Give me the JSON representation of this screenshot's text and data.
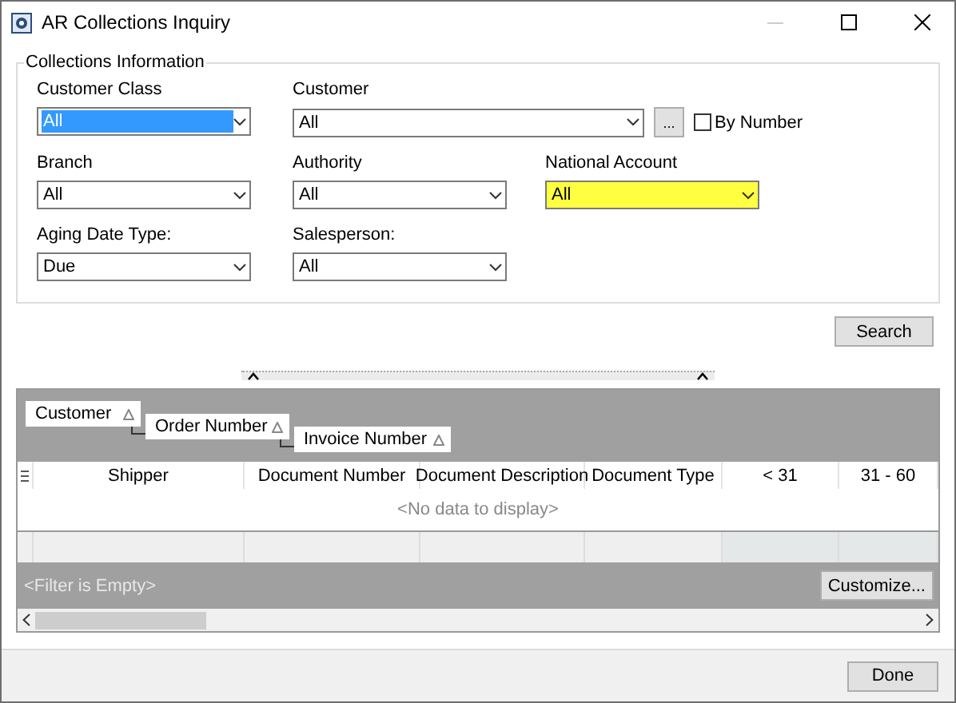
{
  "window": {
    "title": "AR Collections Inquiry"
  },
  "group": {
    "title": "Collections Information",
    "rows": [
      {
        "fields": [
          {
            "label": "Customer Class",
            "value": "All",
            "focused": true,
            "highlighted": false
          },
          {
            "label": "Customer",
            "value": "All",
            "focused": false,
            "highlighted": false,
            "lookup_button": "...",
            "by_number": {
              "label": "By Number",
              "checked": false
            }
          }
        ]
      },
      {
        "fields": [
          {
            "label": "Branch",
            "value": "All",
            "focused": false,
            "highlighted": false
          },
          {
            "label": "Authority",
            "value": "All",
            "focused": false,
            "highlighted": false
          },
          {
            "label": "National Account",
            "value": "All",
            "focused": false,
            "highlighted": true
          }
        ]
      },
      {
        "fields": [
          {
            "label": "Aging Date Type:",
            "value": "Due",
            "focused": false,
            "highlighted": false
          },
          {
            "label": "Salesperson:",
            "value": "All",
            "focused": false,
            "highlighted": false
          }
        ]
      }
    ]
  },
  "search_button": "Search",
  "grid": {
    "group_by": [
      {
        "label": "Customer"
      },
      {
        "label": "Order Number"
      },
      {
        "label": "Invoice Number"
      }
    ],
    "columns": [
      "Shipper",
      "Document Number",
      "Document Description",
      "Document Type",
      "< 31",
      "31 - 60"
    ],
    "empty_text": "<No data to display>",
    "filter_text": "<Filter is Empty>",
    "customize_button": "Customize..."
  },
  "done_button": "Done"
}
